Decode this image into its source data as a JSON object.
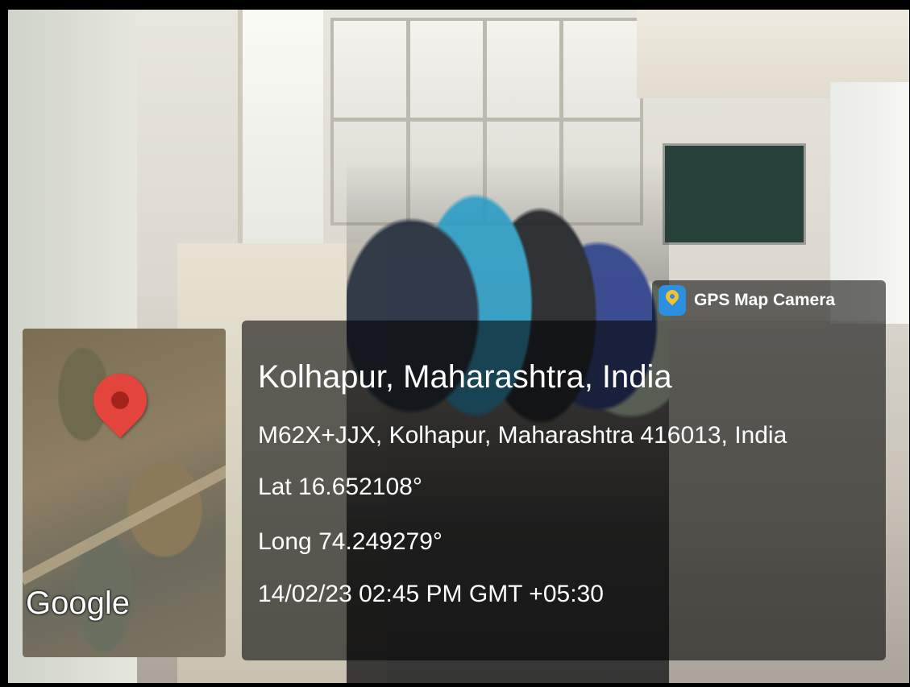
{
  "overlay": {
    "app_name": "GPS Map Camera",
    "place": "Kolhapur, Maharashtra, India",
    "address": "M62X+JJX, Kolhapur, Maharashtra 416013, India",
    "latitude": "Lat 16.652108°",
    "longitude": "Long 74.249279°",
    "timestamp": "14/02/23 02:45 PM GMT +05:30"
  },
  "map": {
    "attribution": "Google",
    "marker_color": "#e3443b"
  },
  "colors": {
    "overlay_bg": "rgba(0,0,0,0.58)",
    "text": "#ffffff",
    "app_icon": "#2c8fe0"
  }
}
